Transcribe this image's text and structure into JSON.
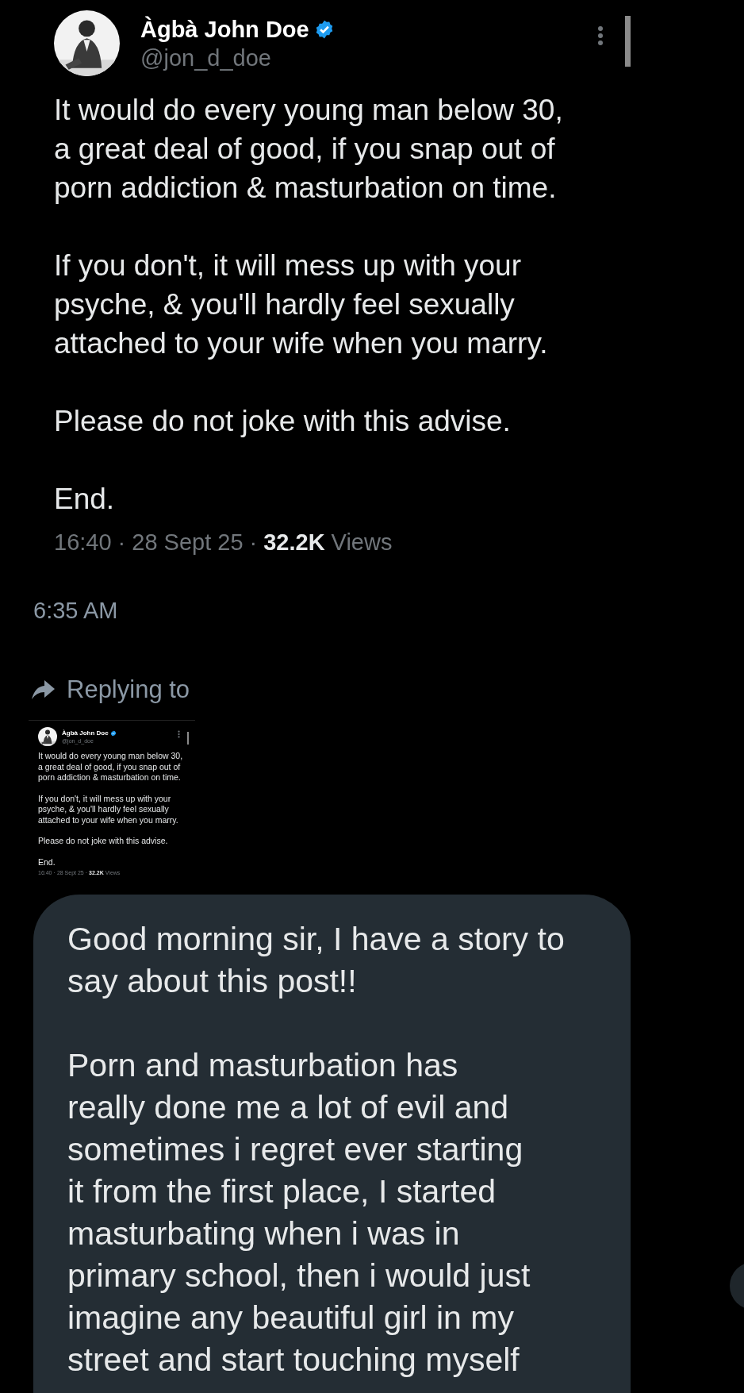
{
  "tweet": {
    "name": "Àgbà John Doe",
    "verified": true,
    "handle": "@jon_d_doe",
    "paragraphs": [
      "It would do every young man below 30,\na great deal of good, if you snap out of\nporn addiction & masturbation on time.",
      "If you don't, it will mess up with your\npsyche, & you'll hardly feel sexually\nattached to your wife when you marry.",
      "Please do not joke with this advise.",
      "End."
    ],
    "time": "16:40",
    "separator": "·",
    "date": "28 Sept 25",
    "views": "32.2K",
    "views_label": "Views"
  },
  "message_time": "6:35 AM",
  "replying_to": "Replying to",
  "reply_preview": {
    "name": "Àgbà John Doe",
    "verified": true,
    "handle": "@jon_d_doe",
    "paragraphs": [
      "It would do every young man below 30,\na great deal of good, if you snap out of\nporn addiction & masturbation on time.",
      "If you don't, it will mess up with your\npsyche, & you'll hardly feel sexually\nattached to your wife when you marry.",
      "Please do not joke with this advise.",
      "End."
    ],
    "time": "16:40",
    "separator": "·",
    "date": "28 Sept 25",
    "views": "32.2K",
    "views_label": "Views"
  },
  "message": {
    "paragraphs": [
      "Good morning sir, I have a story to\nsay about this post!!",
      "Porn and masturbation has\nreally done me a lot of evil and\nsometimes i regret ever starting\nit from the first place, I started\nmasturbating when i was in\nprimary school, then i would just\nimagine any beautiful girl in my\nstreet and start touching myself"
    ]
  }
}
